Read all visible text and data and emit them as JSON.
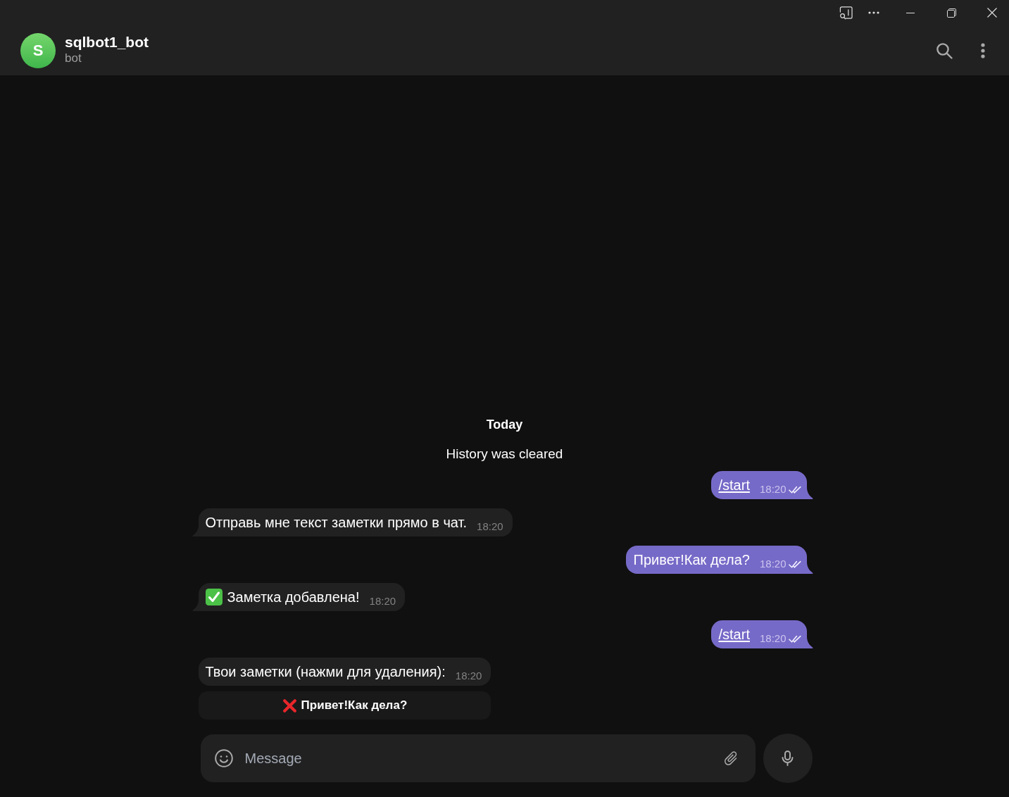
{
  "header": {
    "avatar_initial": "S",
    "title": "sqlbot1_bot",
    "subtitle": "bot"
  },
  "messages": [
    {
      "kind": "date",
      "text": "Today"
    },
    {
      "kind": "service",
      "text": "History was cleared"
    },
    {
      "kind": "outgoing",
      "text": "/start",
      "command": true,
      "time": "18:20",
      "read": true
    },
    {
      "kind": "incoming",
      "text": "Отправь мне текст заметки прямо в чат.",
      "time": "18:20"
    },
    {
      "kind": "outgoing",
      "text": "Привет!Как дела?",
      "command": false,
      "time": "18:20",
      "read": true
    },
    {
      "kind": "confirmation",
      "text": "Заметка добавлена!",
      "time": "18:20"
    },
    {
      "kind": "outgoing",
      "text": "/start",
      "command": true,
      "time": "18:20",
      "read": true
    },
    {
      "kind": "incoming",
      "text": "Твои заметки (нажми для удаления):",
      "time": "18:20",
      "keyboard": [
        {
          "kind": "delete",
          "label": "Привет!Как дела?"
        }
      ]
    }
  ],
  "composer": {
    "placeholder": "Message"
  }
}
